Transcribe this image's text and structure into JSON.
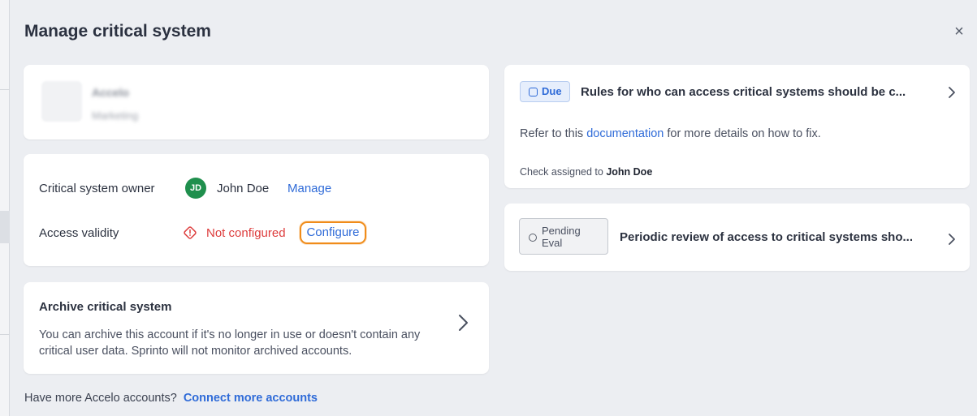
{
  "modal": {
    "title": "Manage critical system",
    "close_label": "×"
  },
  "app": {
    "name": "Accelo",
    "category": "Marketing"
  },
  "owner_section": {
    "owner_label": "Critical system owner",
    "owner_initials": "JD",
    "owner_name": "John Doe",
    "manage_link": "Manage",
    "access_label": "Access validity",
    "access_status": "Not configured",
    "configure_button": "Configure"
  },
  "archive": {
    "title": "Archive critical system",
    "description": "You can archive this account if it's no longer in use or doesn't contain any critical user data. Sprinto will not monitor archived accounts."
  },
  "footer": {
    "text": "Have more Accelo accounts?",
    "link": "Connect more accounts"
  },
  "checks": [
    {
      "status": "Due",
      "title": "Rules for who can access critical systems should be c...",
      "desc_prefix": "Refer to this",
      "desc_link": "documentation",
      "desc_suffix": "for more details on how to fix.",
      "assigned_prefix": "Check assigned to",
      "assigned_to": "John Doe"
    },
    {
      "status": "Pending Eval",
      "title": "Periodic review of access to critical systems sho..."
    }
  ],
  "colors": {
    "accent": "#2f6bd8",
    "warning": "#dd3c3c",
    "highlight": "#f08c1a",
    "avatar": "#1f8f4d"
  }
}
